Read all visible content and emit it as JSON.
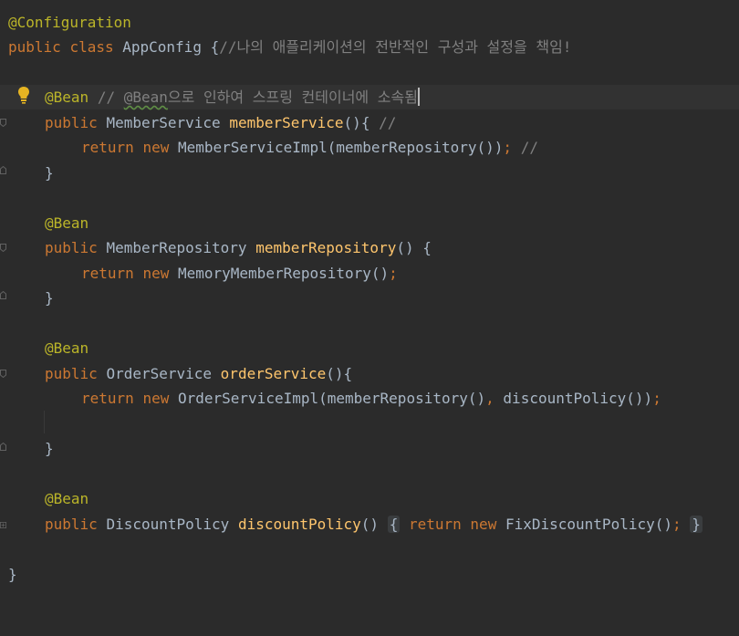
{
  "editor": {
    "line_class_annotation": "@Configuration",
    "line_class_kw_public": "public",
    "line_class_kw_class": "class",
    "line_class_name": "AppConfig",
    "line_class_brace": "{",
    "line_class_comment": "//나의 애플리케이션의 전반적인 구성과 설정을 책임!",
    "bean_annotation": "@Bean",
    "bean1_comment_prefix": "// ",
    "bean1_comment_underlined": "@Bean",
    "bean1_comment_rest": "으로 인하여 스프링 컨테이너에 소속됨",
    "m1_kw_public": "public",
    "m1_type": "MemberService",
    "m1_name": "memberService",
    "m1_sig_rest": "(){",
    "m1_comment": "//",
    "m1_kw_return": "return",
    "m1_kw_new": "new",
    "m1_body": "MemberServiceImpl(memberRepository())",
    "m1_semicolon": ";",
    "m1_body_comment": "//",
    "close_brace": "}",
    "m2_kw_public": "public",
    "m2_type": "MemberRepository",
    "m2_name": "memberRepository",
    "m2_sig_rest": "() {",
    "m2_kw_return": "return",
    "m2_kw_new": "new",
    "m2_body": "MemoryMemberRepository()",
    "m2_semicolon": ";",
    "m3_kw_public": "public",
    "m3_type": "OrderService",
    "m3_name": "orderService",
    "m3_sig_rest": "(){",
    "m3_kw_return": "return",
    "m3_kw_new": "new",
    "m3_body_a": "OrderServiceImpl(memberRepository()",
    "m3_comma": ",",
    "m3_body_b": "discountPolicy())",
    "m3_semicolon": ";",
    "m4_kw_public": "public",
    "m4_type": "DiscountPolicy",
    "m4_name": "discountPolicy",
    "m4_parens": "()",
    "m4_fold_open": "{",
    "m4_kw_return": "return",
    "m4_kw_new": "new",
    "m4_body": "FixDiscountPolicy()",
    "m4_semicolon": ";",
    "m4_fold_close": "}",
    "class_close": "}"
  },
  "colors": {
    "background": "#2b2b2b",
    "current_line": "#323232",
    "annotation": "#bbb529",
    "keyword": "#cc7832",
    "comment": "#808080",
    "method": "#ffc66d",
    "text": "#a9b7c6",
    "bulb": "#e6b422"
  },
  "icons": [
    "intention-bulb-icon",
    "fold-marker-icon"
  ]
}
